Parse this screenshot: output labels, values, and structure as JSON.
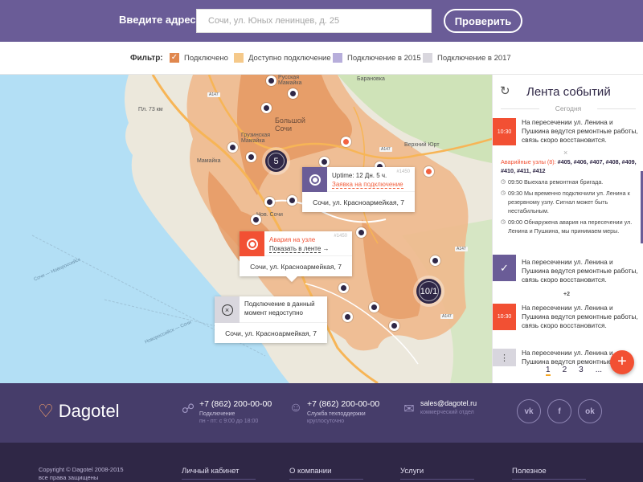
{
  "header": {
    "address_label": "Введите адрес:",
    "address_placeholder": "Сочи, ул. Юных ленинцев, д. 25",
    "check_button": "Проверить"
  },
  "filter": {
    "label": "Фильтр:",
    "options": [
      {
        "label": "Подключено",
        "color": "#e0874e",
        "checked": true
      },
      {
        "label": "Доступно подключение",
        "color": "#f5c98a",
        "checked": false
      },
      {
        "label": "Подключение в 2015",
        "color": "#b7aedb",
        "checked": false
      },
      {
        "label": "Подключение в 2017",
        "color": "#d9d7de",
        "checked": false
      }
    ]
  },
  "map": {
    "labels": {
      "russkaya_mamayka": "Русская\nМамайка",
      "baranovka": "Барановка",
      "pl73km": "Пл. 73 км",
      "bolshoy_sochi": "Большой\nСочи",
      "gruzinka": "Грузинская\nМамайка",
      "mamayka": "Мамайка",
      "verkhniy_yurt": "Верхний Юрт",
      "nov_sochi": "Нов. Сочи",
      "sea_line1": "Сочи — Новороссийск",
      "sea_line2": "Новороссийск — Сочи"
    },
    "road_tags": [
      "A147",
      "A147",
      "A147",
      "A147"
    ],
    "clusters": {
      "c1": "5",
      "c2": "10/1"
    },
    "popups": {
      "uptime": {
        "line1": "Uptime: 12 Дн. 5 ч.",
        "link": "Заявка на подключение",
        "id": "#1450",
        "address": "Сочи, ул. Красноармейкая, 7"
      },
      "alarm": {
        "title": "Авария на узле",
        "link": "Показать в ленте",
        "arrow": "→",
        "id": "#1450",
        "address": "Сочи, ул. Красноармейкая, 7"
      },
      "unavailable": {
        "text": "Подключение в данный момент недоступно",
        "address": "Сочи, ул. Красноармейкая, 7"
      }
    }
  },
  "feed": {
    "title": "Лента событий",
    "today": "Сегодня",
    "close": "×",
    "events": [
      {
        "time": "10:30",
        "text": "На пересечении ул. Ленина и Пушкина ведутся ремонтные работы, связь скоро восстановится."
      },
      {
        "time": "✓",
        "text": "На пересечении ул. Ленина и Пушкина ведутся ремонтные работы, связь скоро восстановится."
      },
      {
        "time": "10:30",
        "text": "На пересечении ул. Ленина и Пушкина ведутся ремонтные работы, связь скоро восстановится."
      },
      {
        "time": "⋮",
        "text": "На пересечении ул. Ленина и Пушкина ведутся ремонтные"
      }
    ],
    "detail": {
      "alarm_label": "Аварийные узлы (8):",
      "nodes": "#405, #406, #407, #408, #409, #410, #411, #412",
      "log": [
        "09:50 Выехала ремонтная бригада.",
        "09:30 Мы временно подключили ул. Ленина к резервному узлу. Сигнал может быть нестабильным.",
        "09:00 Обнаружена авария на пересечении ул. Ленина и Пушкина, мы принимаем меры."
      ]
    },
    "more": "+2",
    "pages": [
      "1",
      "2",
      "3",
      "..."
    ],
    "fab": "+"
  },
  "footer": {
    "logo": "Dagotel",
    "contacts": [
      {
        "icon": "antenna-icon",
        "phone": "+7 (862) 200-00-00",
        "sub1": "Подключение",
        "sub2": "пн - пт: с 9:00 до 18:00"
      },
      {
        "icon": "user-icon",
        "phone": "+7 (862) 200-00-00",
        "sub1": "Служба техподдержки",
        "sub2": "круглосуточно"
      },
      {
        "icon": "mail-tag-icon",
        "phone": "sales@dagotel.ru",
        "sub1": "коммерческий отдел",
        "sub2": ""
      }
    ],
    "social": [
      "vk",
      "f",
      "ok"
    ],
    "copyright_line1": "Copyright © Dagotel 2008-2015",
    "copyright_line2": "все права защищены",
    "nav": [
      "Личный кабинет",
      "О компании",
      "Услуги",
      "Полезное"
    ]
  }
}
